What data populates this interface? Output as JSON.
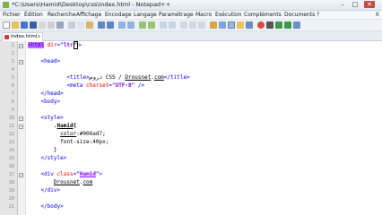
{
  "window": {
    "title": "*C:\\Users\\Hamid\\Desktop\\css\\index.html - Notepad++",
    "controls": [
      "–",
      "□",
      "✕"
    ]
  },
  "menu": [
    "Fichier",
    "Édition",
    "Recherche",
    "Affichage",
    "Encodage",
    "Langage",
    "Paramétrage",
    "Macro",
    "Exécution",
    "Compléments",
    "Documents",
    "?"
  ],
  "menu_close": "X",
  "toolbar_icons": [
    "new-file-icon",
    "open-file-icon",
    "save-icon",
    "save-all-icon",
    "close-icon",
    "close-all-icon",
    "print-icon",
    "cut-icon",
    "copy-icon",
    "paste-icon",
    "undo-icon",
    "redo-icon",
    "find-icon",
    "replace-icon",
    "zoom-in-icon",
    "zoom-out-icon",
    "sync-v-icon",
    "sync-h-icon",
    "word-wrap-icon",
    "show-all-icon",
    "indent-guide-icon",
    "lang-icon",
    "doc-map-icon",
    "function-list-icon",
    "folder-icon",
    "monitor-icon",
    "record-icon",
    "stop-icon",
    "play-icon",
    "play-multi-icon",
    "save-macro-icon"
  ],
  "tab": {
    "label": "index.html",
    "close": "x"
  },
  "editor": {
    "line_numbers": [
      "1",
      "2",
      "3",
      "4",
      "5",
      "6",
      "7",
      "8",
      "9",
      "10",
      "11",
      "12",
      "13",
      "14",
      "15",
      "16",
      "17",
      "18",
      "19",
      "20",
      "21"
    ]
  }
}
